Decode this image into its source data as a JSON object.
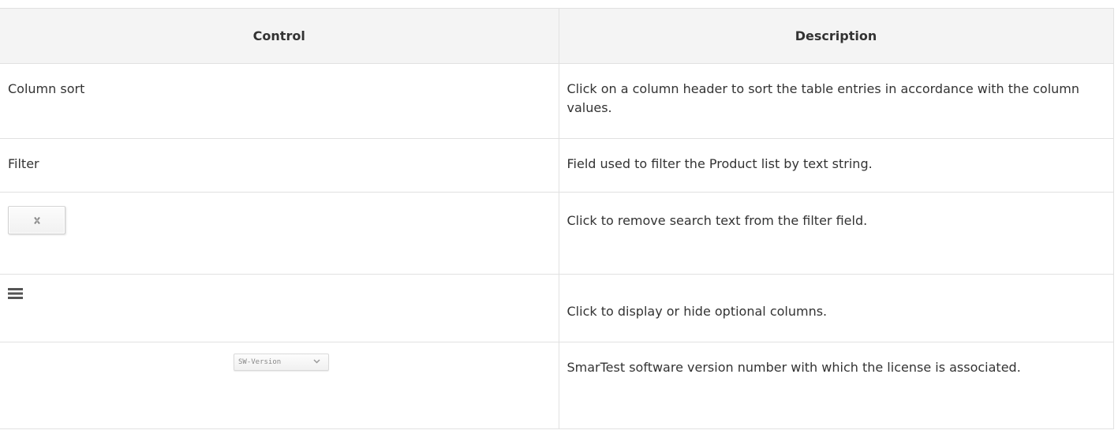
{
  "table": {
    "headers": {
      "control": "Control",
      "description": "Description"
    },
    "rows": [
      {
        "control": "Column sort",
        "description": "Click on a column header to sort the table entries in accordance with the column values."
      },
      {
        "control": "Filter",
        "description": "Field used to filter the Product list by text string."
      },
      {
        "control_icon": "clear-x-button-icon",
        "description": "Click to remove search text from the filter field."
      },
      {
        "control_icon": "columns-menu-icon",
        "description": "Click to display or hide optional columns."
      },
      {
        "control_select": {
          "selected": "SW-Version",
          "icon": "chevron-down-icon"
        },
        "description": "SmarTest software version number with which the license is associated."
      }
    ]
  },
  "colors": {
    "header_bg": "#f4f4f4",
    "border": "#e1e1e1",
    "text": "#333333"
  }
}
